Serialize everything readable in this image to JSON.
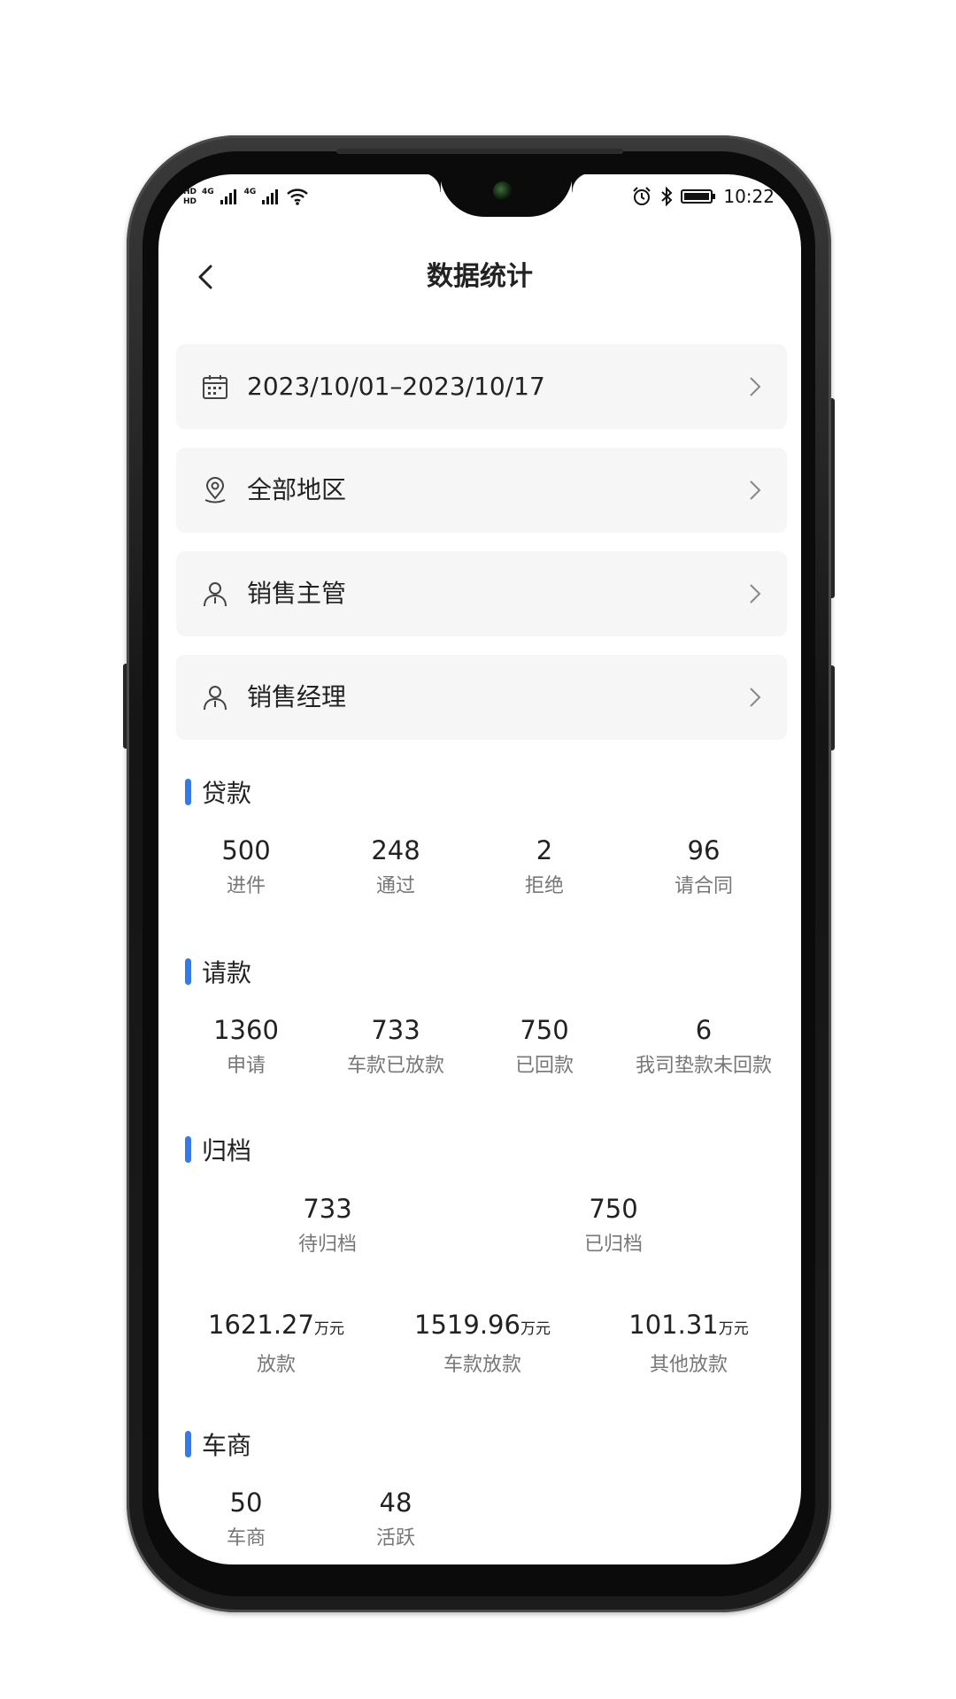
{
  "status_bar": {
    "left": {
      "hd1": "HD",
      "hd2": "HD",
      "net1": "4G",
      "net2": "4G"
    },
    "time": "10:22",
    "icons": [
      "alarm-icon",
      "bluetooth-icon",
      "battery-icon"
    ]
  },
  "header": {
    "title": "数据统计",
    "back_icon": "chevron-left-icon"
  },
  "filters": [
    {
      "icon": "calendar-icon",
      "label": "2023/10/01–2023/10/17"
    },
    {
      "icon": "location-pin-icon",
      "label": "全部地区"
    },
    {
      "icon": "person-icon",
      "label": "销售主管"
    },
    {
      "icon": "person-icon",
      "label": "销售经理"
    }
  ],
  "loan": {
    "title": "贷款",
    "stats": [
      {
        "value": "500",
        "label": "进件"
      },
      {
        "value": "248",
        "label": "通过"
      },
      {
        "value": "2",
        "label": "拒绝"
      },
      {
        "value": "96",
        "label": "请合同"
      }
    ]
  },
  "payment_request": {
    "title": "请款",
    "stats": [
      {
        "value": "1360",
        "label": "申请"
      },
      {
        "value": "733",
        "label": "车款已放款"
      },
      {
        "value": "750",
        "label": "已回款"
      },
      {
        "value": "6",
        "label": "我司垫款未回款"
      }
    ]
  },
  "archive": {
    "title": "归档",
    "stats": [
      {
        "value": "733",
        "label": "待归档"
      },
      {
        "value": "750",
        "label": "已归档"
      }
    ],
    "amounts": [
      {
        "value": "1621.27",
        "unit": "万元",
        "label": "放款"
      },
      {
        "value": "1519.96",
        "unit": "万元",
        "label": "车款放款"
      },
      {
        "value": "101.31",
        "unit": "万元",
        "label": "其他放款"
      }
    ]
  },
  "dealer": {
    "title": "车商",
    "stats": [
      {
        "value": "50",
        "label": "车商"
      },
      {
        "value": "48",
        "label": "活跃"
      }
    ]
  },
  "colors": {
    "accent": "#2f7bf6",
    "card_bg": "#f6f6f6",
    "text_primary": "#222222",
    "text_secondary": "#777777"
  }
}
